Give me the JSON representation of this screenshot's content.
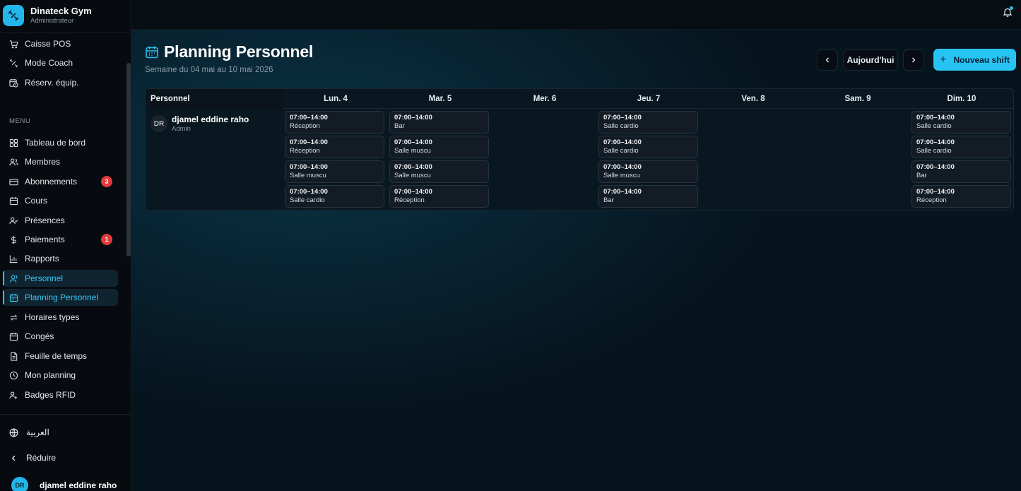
{
  "brand": {
    "name": "Dinateck Gym",
    "role": "Administrateur"
  },
  "nav_top": [
    {
      "label": "Caisse POS",
      "icon": "cart-icon"
    },
    {
      "label": "Mode Coach",
      "icon": "coach-icon"
    },
    {
      "label": "Réserv. équip.",
      "icon": "calendar-clock-icon"
    }
  ],
  "menu_label": "MENU",
  "nav_menu": [
    {
      "label": "Tableau de bord",
      "icon": "dashboard-icon",
      "badge": ""
    },
    {
      "label": "Membres",
      "icon": "users-icon",
      "badge": ""
    },
    {
      "label": "Abonnements",
      "icon": "card-icon",
      "badge": "3"
    },
    {
      "label": "Cours",
      "icon": "calendar-icon",
      "badge": ""
    },
    {
      "label": "Présences",
      "icon": "user-check-icon",
      "badge": ""
    },
    {
      "label": "Paiements",
      "icon": "dollar-icon",
      "badge": "1"
    },
    {
      "label": "Rapports",
      "icon": "bar-chart-icon",
      "badge": ""
    },
    {
      "label": "Personnel",
      "icon": "user-icon",
      "badge": ""
    },
    {
      "label": "Planning Personnel",
      "icon": "calendar-grid-icon",
      "badge": ""
    },
    {
      "label": "Horaires types",
      "icon": "repeat-icon",
      "badge": ""
    },
    {
      "label": "Congés",
      "icon": "calendar-icon",
      "badge": ""
    },
    {
      "label": "Feuille de temps",
      "icon": "document-icon",
      "badge": ""
    },
    {
      "label": "Mon planning",
      "icon": "clock-icon",
      "badge": ""
    },
    {
      "label": "Badges RFID",
      "icon": "user-badge-icon",
      "badge": ""
    }
  ],
  "bottom": {
    "language": "العربية",
    "collapse": "Réduire"
  },
  "current_user": {
    "initials": "DR",
    "name": "djamel eddine raho"
  },
  "page": {
    "title": "Planning Personnel",
    "subtitle": "Semaine du 04 mai au 10 mai 2026",
    "today_label": "Aujourd'hui",
    "new_shift_label": "Nouveau shift"
  },
  "table": {
    "person_header": "Personnel",
    "days": [
      "Lun. 4",
      "Mar. 5",
      "Mer. 6",
      "Jeu. 7",
      "Ven. 8",
      "Sam. 9",
      "Dim. 10"
    ],
    "employee": {
      "initials": "DR",
      "name": "djamel eddine raho",
      "role": "Admin"
    },
    "shifts": {
      "lun": [
        {
          "time": "07:00–14:00",
          "place": "Réception"
        },
        {
          "time": "07:00–14:00",
          "place": "Réception"
        },
        {
          "time": "07:00–14:00",
          "place": "Salle muscu"
        },
        {
          "time": "07:00–14:00",
          "place": "Salle cardio"
        }
      ],
      "mar": [
        {
          "time": "07:00–14:00",
          "place": "Bar"
        },
        {
          "time": "07:00–14:00",
          "place": "Salle muscu"
        },
        {
          "time": "07:00–14:00",
          "place": "Salle muscu"
        },
        {
          "time": "07:00–14:00",
          "place": "Réception"
        }
      ],
      "jeu": [
        {
          "time": "07:00–14:00",
          "place": "Salle cardio"
        },
        {
          "time": "07:00–14:00",
          "place": "Salle cardio"
        },
        {
          "time": "07:00–14:00",
          "place": "Salle muscu"
        },
        {
          "time": "07:00–14:00",
          "place": "Bar"
        }
      ],
      "dim": [
        {
          "time": "07:00–14:00",
          "place": "Salle cardio"
        },
        {
          "time": "07:00–14:00",
          "place": "Salle cardio"
        },
        {
          "time": "07:00–14:00",
          "place": "Bar"
        },
        {
          "time": "07:00–14:00",
          "place": "Réception"
        }
      ]
    }
  },
  "colors": {
    "accent": "#27c3f2",
    "badge": "#e33b3b",
    "active_bg": "#0f2430"
  }
}
